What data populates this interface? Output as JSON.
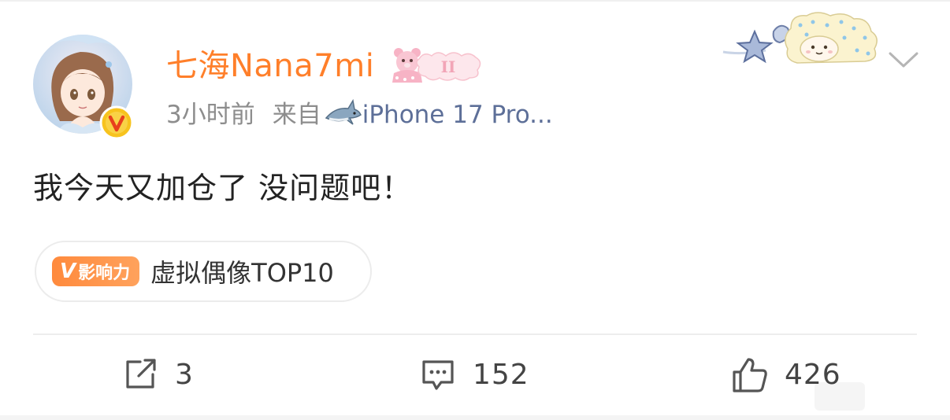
{
  "post": {
    "author": {
      "name": "七海Nana7mi",
      "avatar_icon": "anime-girl-avatar",
      "verified_icon": "verified-v-badge",
      "member_badge_icon": "member-badge-ii"
    },
    "meta": {
      "time": "3小时前",
      "source_prefix": "来自",
      "source_icon": "shark-icon",
      "device": "iPhone 17 Pro..."
    },
    "text": "我今天又加仓了 没问题吧！",
    "topic": {
      "badge_v": "V",
      "badge_label": "影响力",
      "label": "虚拟偶像TOP10"
    },
    "actions": {
      "reposts": "3",
      "comments": "152",
      "likes": "426"
    }
  },
  "colors": {
    "username": "#ff7f2a",
    "device_link": "#5d6f98",
    "meta_gray": "#8d8d8d",
    "badge_orange": "#ff8a3d",
    "verified_yellow": "#f7c31e"
  }
}
